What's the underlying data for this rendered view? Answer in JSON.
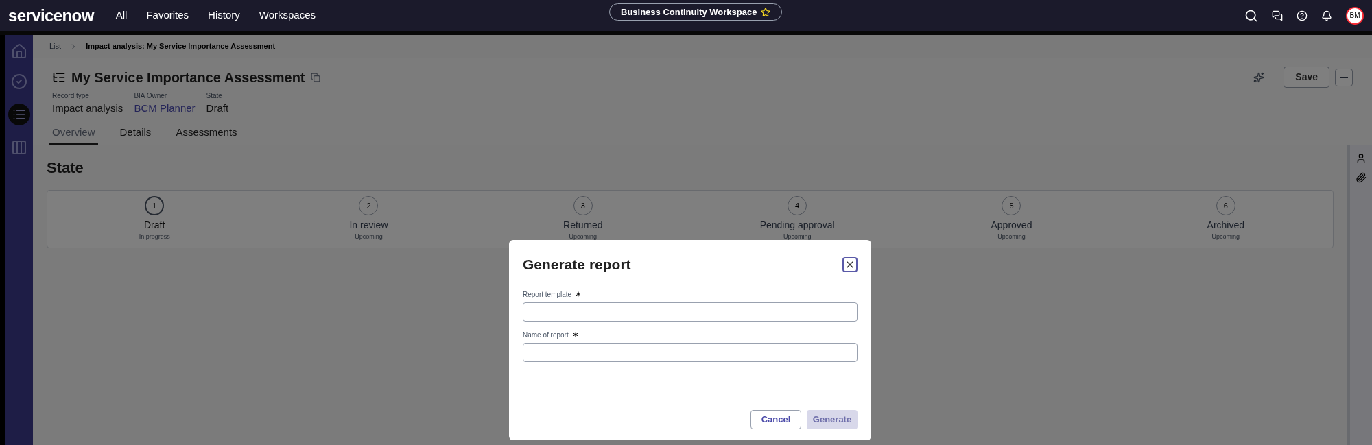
{
  "top_bar": {
    "logo": "servicenow",
    "nav": [
      "All",
      "Favorites",
      "History",
      "Workspaces"
    ],
    "workspace": "Business Continuity Workspace",
    "avatar": "BM"
  },
  "breadcrumb": {
    "parent": "List",
    "current": "Impact analysis: My Service Importance Assessment"
  },
  "record": {
    "title": "My Service Importance Assessment",
    "fields": [
      {
        "label": "Record type",
        "value": "Impact analysis",
        "kind": "text"
      },
      {
        "label": "BIA Owner",
        "value": "BCM Planner",
        "kind": "link"
      },
      {
        "label": "State",
        "value": "Draft",
        "kind": "text"
      }
    ],
    "save": "Save"
  },
  "tabs": [
    {
      "label": "Overview",
      "selected": true
    },
    {
      "label": "Details",
      "selected": false
    },
    {
      "label": "Assessments",
      "selected": false
    }
  ],
  "state": {
    "title": "State",
    "steps": [
      {
        "number": "1",
        "label": "Draft",
        "status": "In progress",
        "selected": true
      },
      {
        "number": "2",
        "label": "In review",
        "status": "Upcoming",
        "selected": false
      },
      {
        "number": "3",
        "label": "Returned",
        "status": "Upcoming",
        "selected": false
      },
      {
        "number": "4",
        "label": "Pending approval",
        "status": "Upcoming",
        "selected": false
      },
      {
        "number": "5",
        "label": "Approved",
        "status": "Upcoming",
        "selected": false
      },
      {
        "number": "6",
        "label": "Archived",
        "status": "Upcoming",
        "selected": false
      }
    ]
  },
  "dialog": {
    "title": "Generate report",
    "fields": [
      {
        "label": "Report template",
        "required": true
      },
      {
        "label": "Name of report",
        "required": true
      }
    ],
    "buttons": [
      {
        "label": "Cancel",
        "disabled": false
      },
      {
        "label": "Generate",
        "disabled": true
      }
    ]
  }
}
